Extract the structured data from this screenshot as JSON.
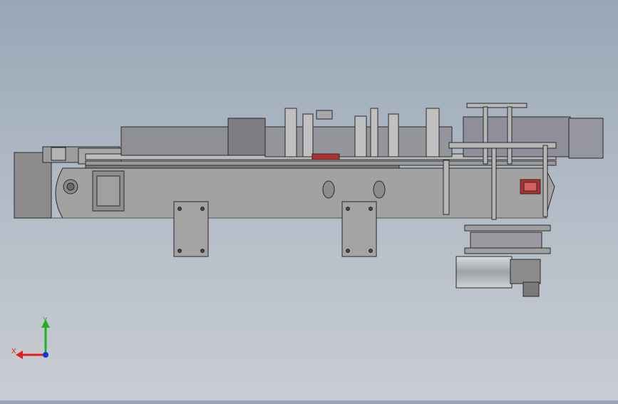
{
  "view": {
    "background_top": "#9aa6b6",
    "background_bottom": "#c9cdd3",
    "model": "labeling-machine-front-view"
  },
  "triad": {
    "x_label": "X",
    "y_label": "Y",
    "x_color": "#e02020",
    "y_color": "#20b020",
    "z_color": "#2030e0"
  },
  "colors": {
    "frame": "#a2a2a2",
    "frame_dark": "#8a8a8a",
    "outline": "#2a2a2a",
    "housing": "#909098",
    "motor": "#b0b4b8",
    "accent_red": "#b03030"
  }
}
